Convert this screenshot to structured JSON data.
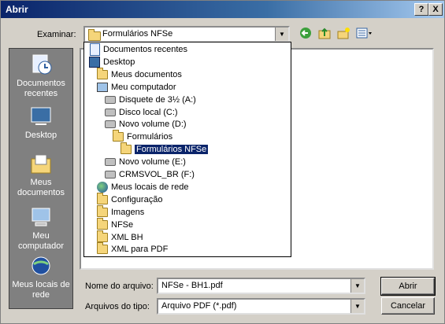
{
  "window": {
    "title": "Abrir",
    "help_label": "?",
    "close_label": "X"
  },
  "toolbar": {
    "look_in_label": "Examinar:",
    "look_in_value": "Formulários NFSe",
    "back_icon": "back-arrow-icon",
    "up_icon": "up-folder-icon",
    "new_folder_icon": "new-folder-icon",
    "views_icon": "views-menu-icon"
  },
  "places": [
    {
      "label": "Documentos recentes",
      "icon": "recent-documents-icon"
    },
    {
      "label": "Desktop",
      "icon": "desktop-icon"
    },
    {
      "label": "Meus documentos",
      "icon": "my-documents-icon"
    },
    {
      "label": "Meu computador",
      "icon": "my-computer-icon"
    },
    {
      "label": "Meus locais de rede",
      "icon": "network-places-icon"
    }
  ],
  "dropdown": [
    {
      "label": "Documentos recentes",
      "indent": 0,
      "icon": "doc"
    },
    {
      "label": "Desktop",
      "indent": 0,
      "icon": "desk"
    },
    {
      "label": "Meus documentos",
      "indent": 1,
      "icon": "folder"
    },
    {
      "label": "Meu computador",
      "indent": 1,
      "icon": "pc"
    },
    {
      "label": "Disquete de 3½ (A:)",
      "indent": 2,
      "icon": "drive"
    },
    {
      "label": "Disco local (C:)",
      "indent": 2,
      "icon": "drive"
    },
    {
      "label": "Novo volume (D:)",
      "indent": 2,
      "icon": "drive"
    },
    {
      "label": "Formulários",
      "indent": 3,
      "icon": "folder"
    },
    {
      "label": "Formulários NFSe",
      "indent": 4,
      "icon": "folder",
      "selected": true
    },
    {
      "label": "Novo volume (E:)",
      "indent": 2,
      "icon": "drive"
    },
    {
      "label": "CRMSVOL_BR (F:)",
      "indent": 2,
      "icon": "drive"
    },
    {
      "label": "Meus locais de rede",
      "indent": 1,
      "icon": "net"
    },
    {
      "label": "Configuração",
      "indent": 1,
      "icon": "folder"
    },
    {
      "label": "Imagens",
      "indent": 1,
      "icon": "folder"
    },
    {
      "label": "NFSe",
      "indent": 1,
      "icon": "folder"
    },
    {
      "label": "XML BH",
      "indent": 1,
      "icon": "folder"
    },
    {
      "label": "XML para PDF",
      "indent": 1,
      "icon": "folder"
    }
  ],
  "filename": {
    "label": "Nome do arquivo:",
    "value": "NFSe - BH1.pdf"
  },
  "filetype": {
    "label": "Arquivos do tipo:",
    "value": "Arquivo PDF (*.pdf)"
  },
  "buttons": {
    "open": "Abrir",
    "cancel": "Cancelar"
  }
}
